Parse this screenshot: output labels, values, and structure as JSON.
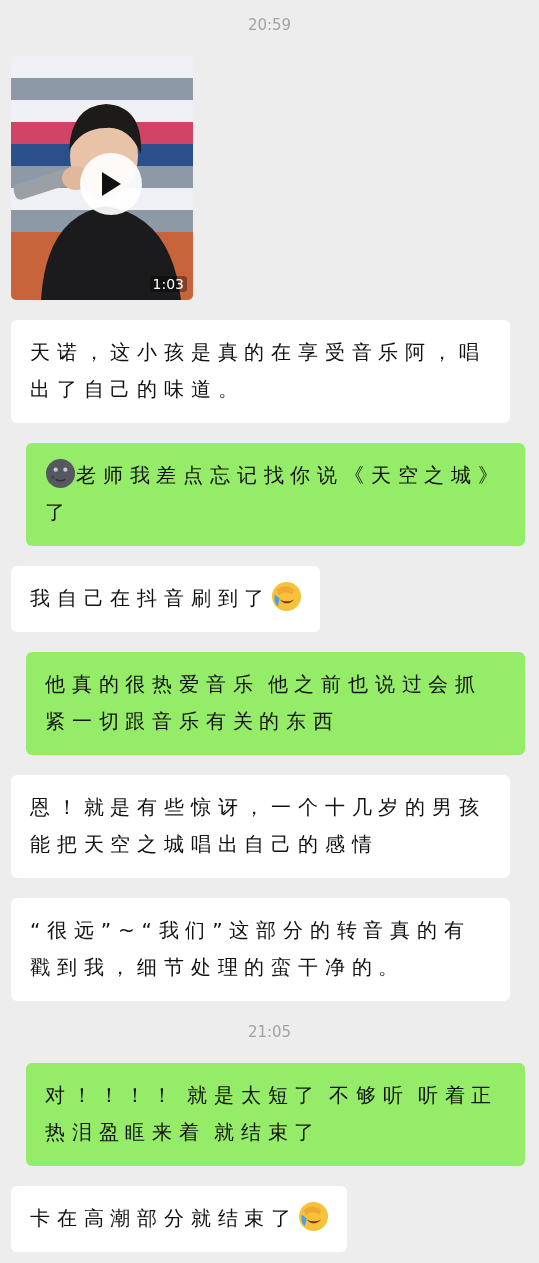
{
  "items": [
    {
      "kind": "time",
      "text": "20:59"
    },
    {
      "kind": "video",
      "outgoing": false,
      "duration": "1:03"
    },
    {
      "kind": "message",
      "outgoing": false,
      "parts": [
        {
          "kind": "text",
          "text": "天诺，这小孩是真的在享受音乐阿，唱出了自己的味道。"
        }
      ]
    },
    {
      "kind": "message",
      "outgoing": true,
      "parts": [
        {
          "kind": "moon_emoji"
        },
        {
          "kind": "text",
          "text": "老师我差点忘记找你说《天空之城》了"
        }
      ]
    },
    {
      "kind": "message",
      "outgoing": false,
      "parts": [
        {
          "kind": "text",
          "text": "我自己在抖音刷到了"
        },
        {
          "kind": "crying_emoji"
        }
      ]
    },
    {
      "kind": "message",
      "outgoing": true,
      "parts": [
        {
          "kind": "text",
          "text": "他真的很热爱音乐 他之前也说过会抓紧一切跟音乐有关的东西"
        }
      ]
    },
    {
      "kind": "message",
      "outgoing": false,
      "parts": [
        {
          "kind": "text",
          "text": "恩！就是有些惊讶，一个十几岁的男孩能把天空之城唱出自己的感情"
        }
      ]
    },
    {
      "kind": "message",
      "outgoing": false,
      "parts": [
        {
          "kind": "text",
          "text": "“很远”~“我们”这部分的转音真的有戳到我，细节处理的蛮干净的。"
        }
      ]
    },
    {
      "kind": "time",
      "text": "21:05"
    },
    {
      "kind": "message",
      "outgoing": true,
      "parts": [
        {
          "kind": "text",
          "text": "对！！！！ 就是太短了 不够听 听着正热泪盈眶来着 就结束了"
        }
      ]
    },
    {
      "kind": "message",
      "outgoing": false,
      "parts": [
        {
          "kind": "text",
          "text": "卡在高潮部分就结束了"
        },
        {
          "kind": "crying_emoji"
        }
      ]
    }
  ]
}
